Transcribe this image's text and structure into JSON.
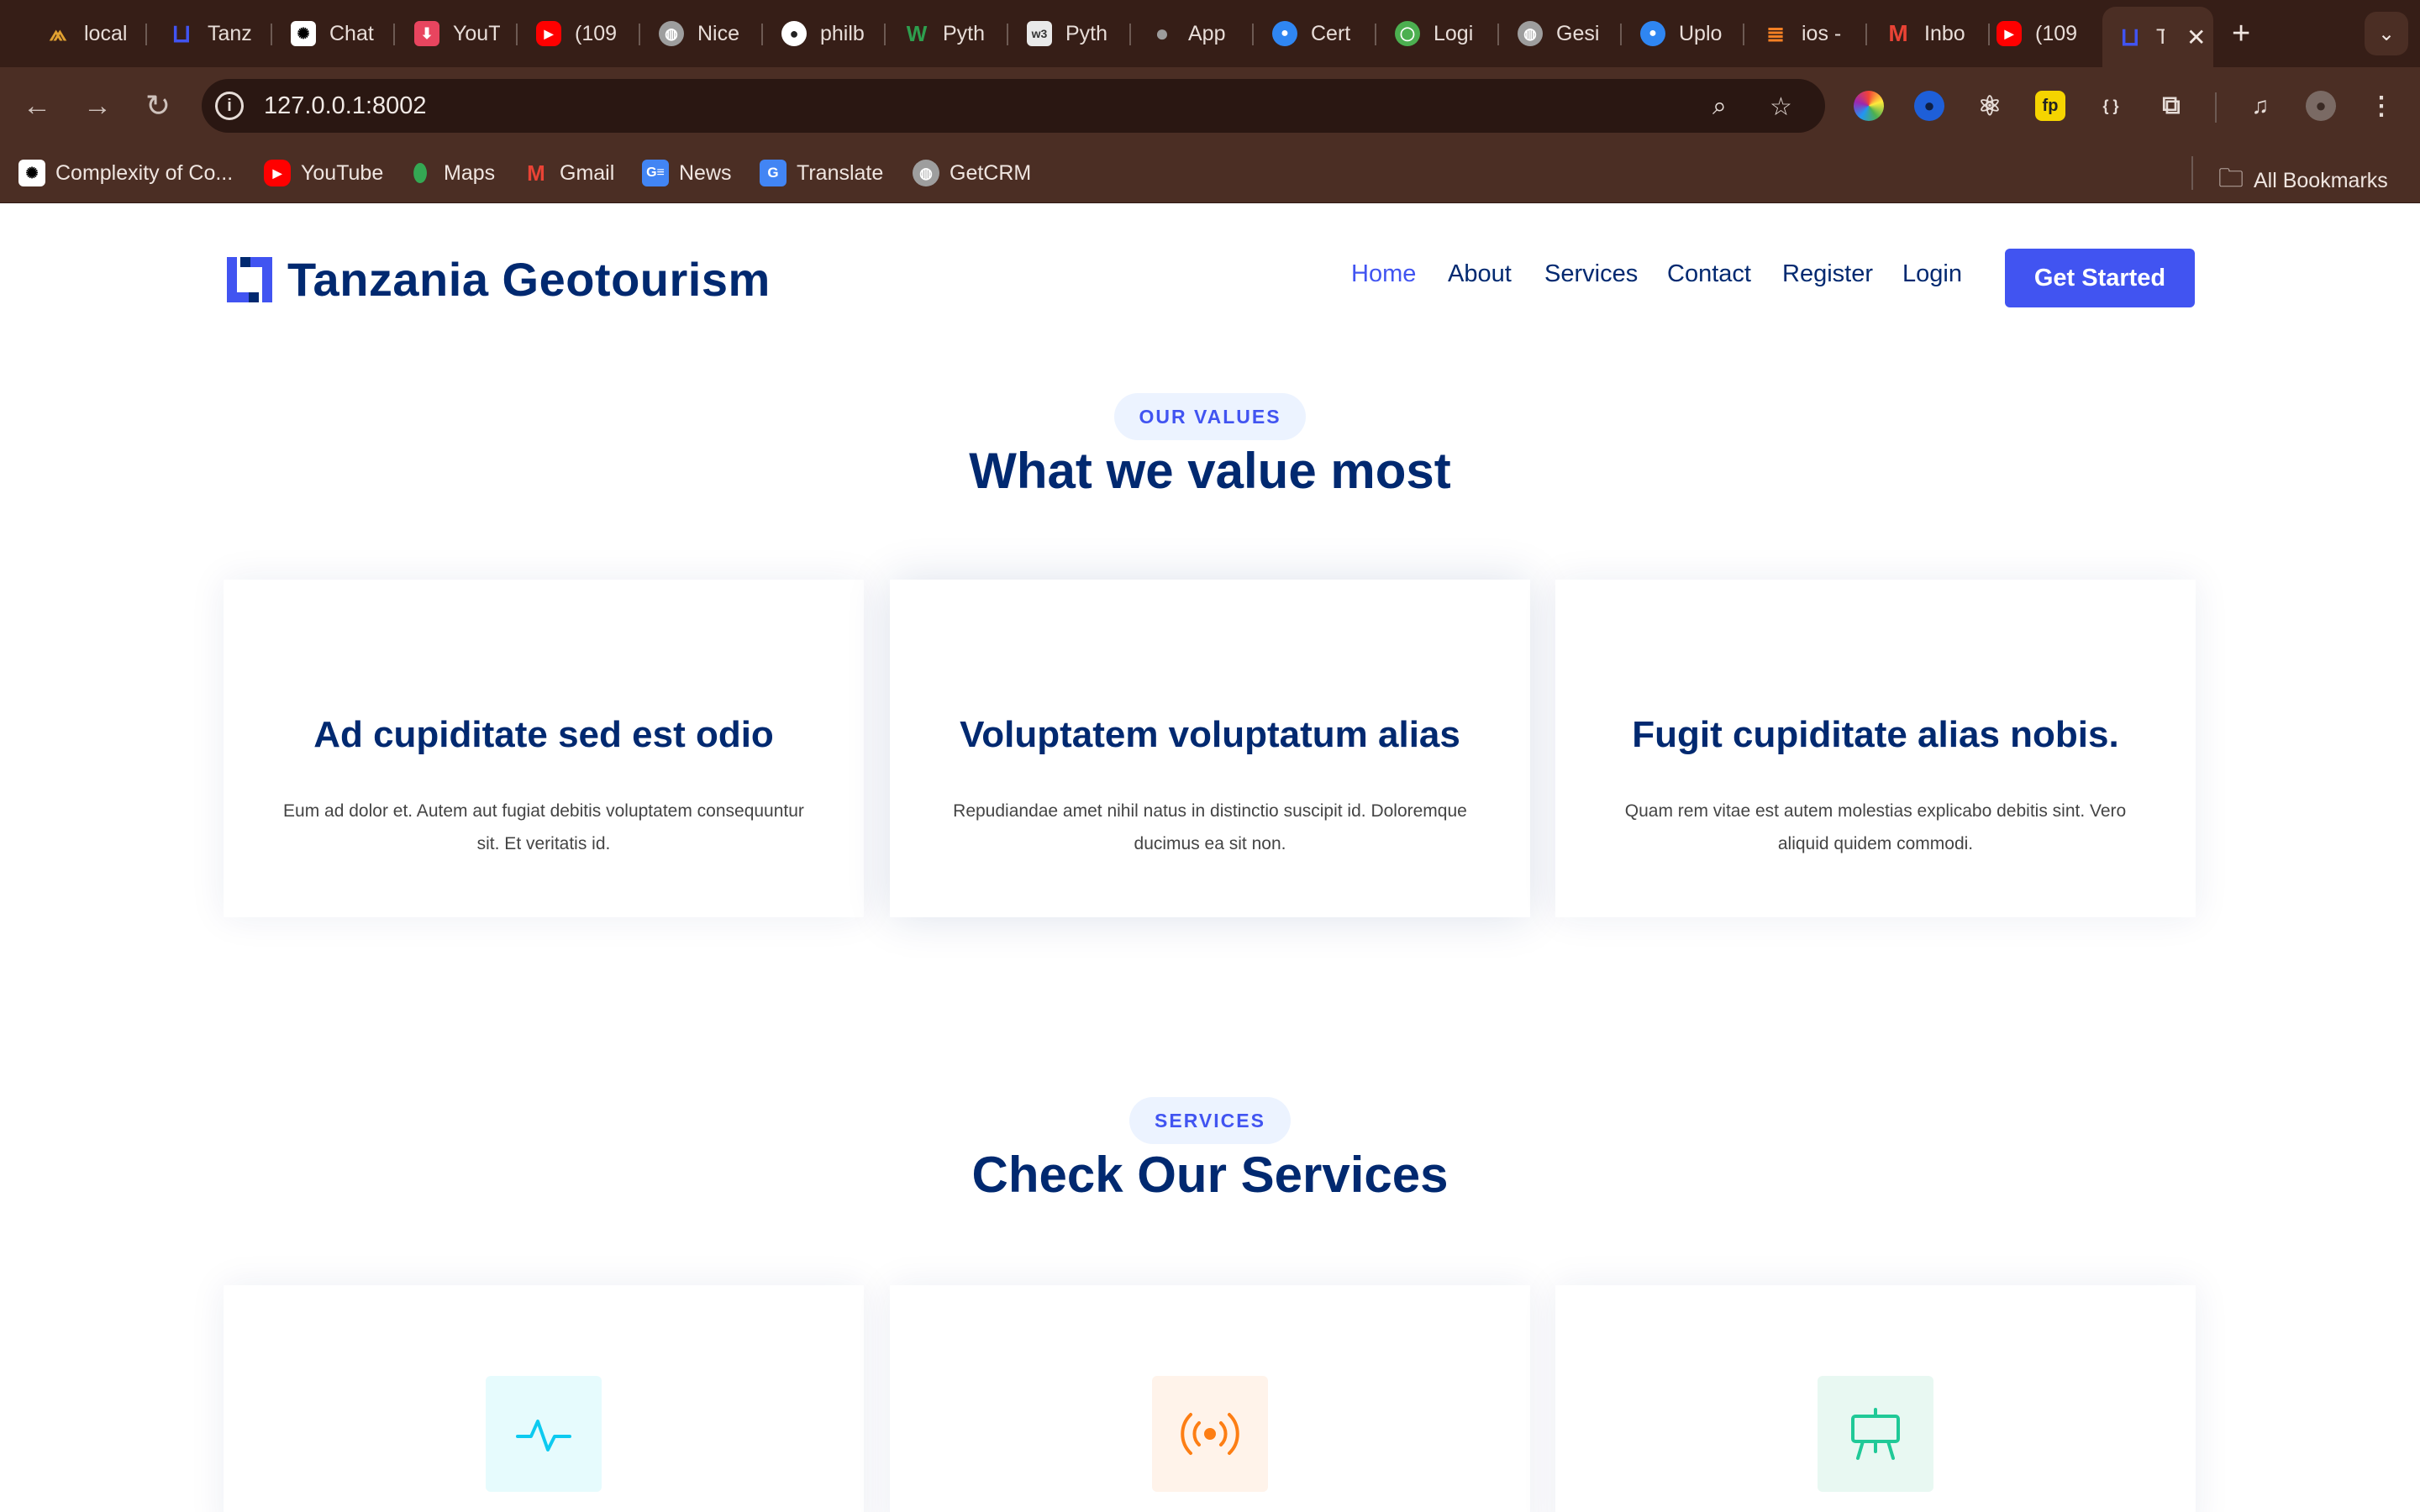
{
  "browser": {
    "tabs": [
      {
        "label": "local",
        "icon": "reward-icon",
        "color": "#e0a030"
      },
      {
        "label": "Tanz",
        "icon": "site-logo-icon",
        "color": "#4154f1"
      },
      {
        "label": "Chat",
        "icon": "chatgpt-icon",
        "color": "#ffffff"
      },
      {
        "label": "YouT",
        "icon": "download-icon",
        "color": "#e8455f"
      },
      {
        "label": "(109",
        "icon": "youtube-icon",
        "color": "#ff0000"
      },
      {
        "label": "Nice",
        "icon": "globe-icon",
        "color": "#9e9e9e"
      },
      {
        "label": "philb",
        "icon": "github-icon",
        "color": "#ffffff"
      },
      {
        "label": "Pyth",
        "icon": "w-icon",
        "color": "#2e9e4e"
      },
      {
        "label": "Pyth",
        "icon": "w3-icon",
        "color": "#e9e9e9"
      },
      {
        "label": "App",
        "icon": "apple-icon",
        "color": "#8f8f8f"
      },
      {
        "label": "Cert",
        "icon": "apple-dev-icon",
        "color": "#2f86f2"
      },
      {
        "label": "Logi",
        "icon": "login-icon",
        "color": "#4caf50"
      },
      {
        "label": "Gesi",
        "icon": "globe-icon",
        "color": "#9e9e9e"
      },
      {
        "label": "Uplo",
        "icon": "apple-dev-icon",
        "color": "#2f86f2"
      },
      {
        "label": "ios -",
        "icon": "stackoverflow-icon",
        "color": "#f48024"
      },
      {
        "label": "Inbo",
        "icon": "gmail-icon",
        "color": "#ea4335"
      },
      {
        "label": "(109",
        "icon": "youtube-icon",
        "color": "#ff0000"
      }
    ],
    "active_tab": {
      "label": "T",
      "icon": "site-logo-icon"
    },
    "url": "127.0.0.1:8002",
    "bookmarks": [
      {
        "label": "Complexity of Co...",
        "icon": "chatgpt-icon",
        "color": "#ffffff"
      },
      {
        "label": "YouTube",
        "icon": "youtube-icon",
        "color": "#ff0000"
      },
      {
        "label": "Maps",
        "icon": "maps-icon",
        "color": "#34a853"
      },
      {
        "label": "Gmail",
        "icon": "gmail-icon",
        "color": "#ea4335"
      },
      {
        "label": "News",
        "icon": "news-icon",
        "color": "#4285f4"
      },
      {
        "label": "Translate",
        "icon": "translate-icon",
        "color": "#4285f4"
      },
      {
        "label": "GetCRM",
        "icon": "globe-icon",
        "color": "#9e9e9e"
      }
    ],
    "all_bookmarks": "All Bookmarks"
  },
  "site": {
    "brand": "Tanzania Geotourism",
    "nav": [
      "Home",
      "About",
      "Services",
      "Contact",
      "Register",
      "Login"
    ],
    "cta": "Get Started",
    "accent": "#4154f1",
    "heading_color": "#012970"
  },
  "values": {
    "pill": "OUR VALUES",
    "title": "What we value most",
    "cards": [
      {
        "title": "Ad cupiditate sed est odio",
        "text": "Eum ad dolor et. Autem aut fugiat debitis voluptatem consequuntur sit. Et veritatis id."
      },
      {
        "title": "Voluptatem voluptatum alias",
        "text": "Repudiandae amet nihil natus in distinctio suscipit id. Doloremque ducimus ea sit non."
      },
      {
        "title": "Fugit cupiditate alias nobis.",
        "text": "Quam rem vitae est autem molestias explicabo debitis sint. Vero aliquid quidem commodi."
      }
    ]
  },
  "services": {
    "pill": "SERVICES",
    "title": "Check Our Services",
    "icons": [
      {
        "name": "activity-icon",
        "bg": "#e6fbfd",
        "color": "#0dcaf0"
      },
      {
        "name": "broadcast-icon",
        "bg": "#fff3ea",
        "color": "#fd7e14"
      },
      {
        "name": "easel-icon",
        "bg": "#e8f8f2",
        "color": "#20c997"
      }
    ]
  }
}
